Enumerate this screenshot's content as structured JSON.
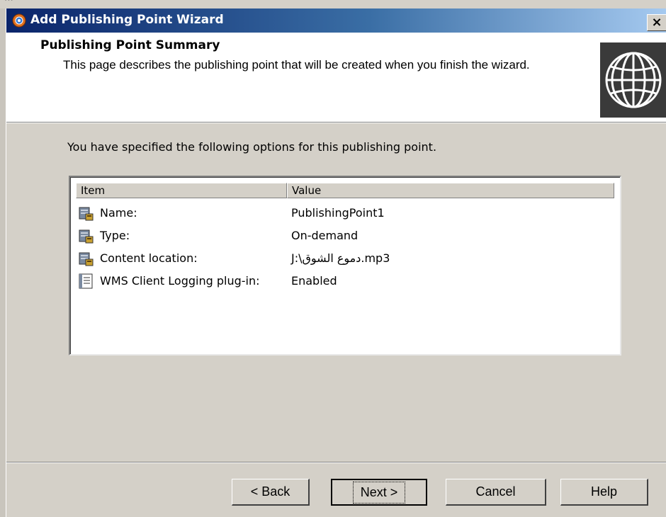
{
  "window": {
    "title": "Add Publishing Point Wizard",
    "close_label": "×"
  },
  "header": {
    "title": "Publishing Point Summary",
    "description": "This page describes the publishing point that will be created when you finish the wizard."
  },
  "intro_text": "You have specified the following options for this publishing point.",
  "list": {
    "columns": [
      "Item",
      "Value"
    ],
    "rows": [
      {
        "name": "Name:",
        "value": "PublishingPoint1",
        "icon": "server-icon"
      },
      {
        "name": "Type:",
        "value": "On-demand",
        "icon": "server-icon"
      },
      {
        "name": "Content location:",
        "value": "J:\\دموع الشوق.mp3",
        "icon": "server-icon"
      },
      {
        "name": "WMS Client Logging plug-in:",
        "value": "Enabled",
        "icon": "log-plugin-icon"
      }
    ]
  },
  "buttons": {
    "back": "< Back",
    "next": "Next >",
    "cancel": "Cancel",
    "help": "Help"
  },
  "colors": {
    "title_start": "#0a246a",
    "title_end": "#a6caf0",
    "dialog_bg": "#d4d0c8"
  }
}
